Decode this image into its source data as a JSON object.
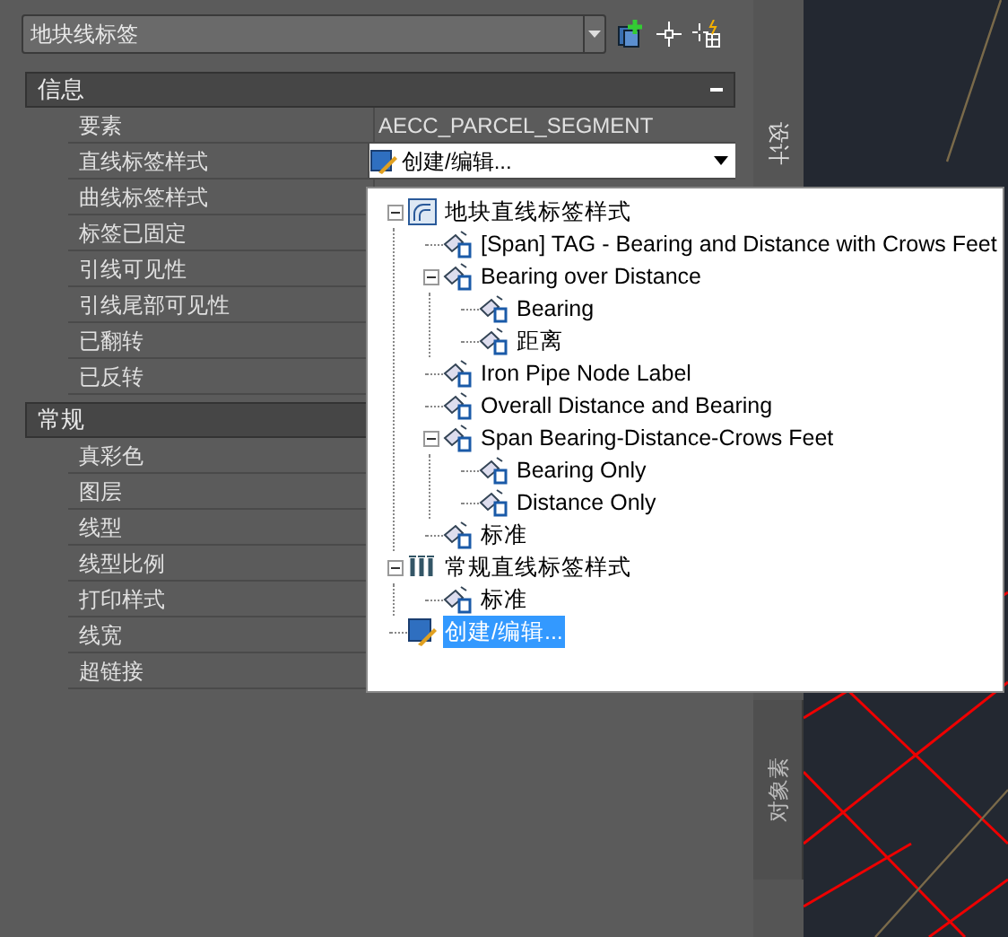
{
  "object_selector": {
    "value": "地块线标签"
  },
  "sections": [
    {
      "title": "信息",
      "expanded": true,
      "rows": [
        {
          "label": "要素",
          "value": "AECC_PARCEL_SEGMENT",
          "kind": "text"
        },
        {
          "label": "直线标签样式",
          "value": "创建/编辑...",
          "kind": "dropdown"
        },
        {
          "label": "曲线标签样式"
        },
        {
          "label": "标签已固定"
        },
        {
          "label": "引线可见性"
        },
        {
          "label": "引线尾部可见性"
        },
        {
          "label": "已翻转"
        },
        {
          "label": "已反转"
        }
      ]
    },
    {
      "title": "常规",
      "rows": [
        {
          "label": "真彩色"
        },
        {
          "label": "图层"
        },
        {
          "label": "线型"
        },
        {
          "label": "线型比例"
        },
        {
          "label": "打印样式"
        },
        {
          "label": "线宽"
        },
        {
          "label": "超链接"
        }
      ]
    }
  ],
  "side_tabs": [
    {
      "label": "设计"
    },
    {
      "label": "对象素"
    }
  ],
  "dropdown_tree": [
    {
      "label": "地块直线标签样式",
      "kind": "collection",
      "expanded": true,
      "selected": false,
      "children": [
        {
          "label": "[Span] TAG - Bearing and Distance with Crows Feet",
          "kind": "style",
          "selected": false
        },
        {
          "label": "Bearing over Distance",
          "kind": "style",
          "expanded": true,
          "selected": false,
          "children": [
            {
              "label": "Bearing",
              "kind": "style",
              "selected": false
            },
            {
              "label": "距离",
              "kind": "style",
              "selected": false
            }
          ]
        },
        {
          "label": "Iron Pipe Node Label",
          "kind": "style",
          "selected": false
        },
        {
          "label": "Overall Distance and Bearing",
          "kind": "style",
          "selected": false
        },
        {
          "label": "Span Bearing-Distance-Crows Feet",
          "kind": "style",
          "expanded": true,
          "selected": false,
          "children": [
            {
              "label": "Bearing Only",
              "kind": "style",
              "selected": false
            },
            {
              "label": "Distance Only",
              "kind": "style",
              "selected": false
            }
          ]
        },
        {
          "label": "标准",
          "kind": "style",
          "selected": false
        }
      ]
    },
    {
      "label": "常规直线标签样式",
      "kind": "general",
      "expanded": true,
      "selected": false,
      "children": [
        {
          "label": "标准",
          "kind": "style",
          "selected": false
        }
      ]
    },
    {
      "label": "创建/编辑...",
      "kind": "create",
      "selected": true
    }
  ]
}
